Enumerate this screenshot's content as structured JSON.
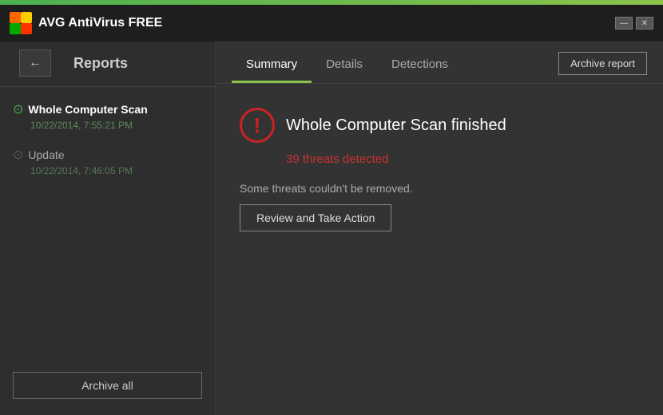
{
  "titleBar": {
    "appName": "AVG  AntiVirus FREE",
    "logoText": "AVG"
  },
  "windowControls": {
    "minimizeLabel": "—",
    "closeLabel": "✕"
  },
  "sidebar": {
    "title": "Reports",
    "backIcon": "←",
    "items": [
      {
        "id": "whole-computer-scan",
        "name": "Whole Computer Scan",
        "date": "10/22/2014, 7:55:21 PM",
        "active": true
      },
      {
        "id": "update",
        "name": "Update",
        "date": "10/22/2014, 7:46:05 PM",
        "active": false
      }
    ],
    "archiveAllLabel": "Archive all"
  },
  "content": {
    "tabs": [
      {
        "id": "summary",
        "label": "Summary",
        "active": true
      },
      {
        "id": "details",
        "label": "Details",
        "active": false
      },
      {
        "id": "detections",
        "label": "Detections",
        "active": false
      }
    ],
    "archiveReportLabel": "Archive report",
    "scanTitle": "Whole Computer Scan finished",
    "threatsDetected": "39 threats detected",
    "someThreatsText": "Some threats couldn't be removed.",
    "reviewActionLabel": "Review and Take Action",
    "warningSymbol": "!"
  }
}
